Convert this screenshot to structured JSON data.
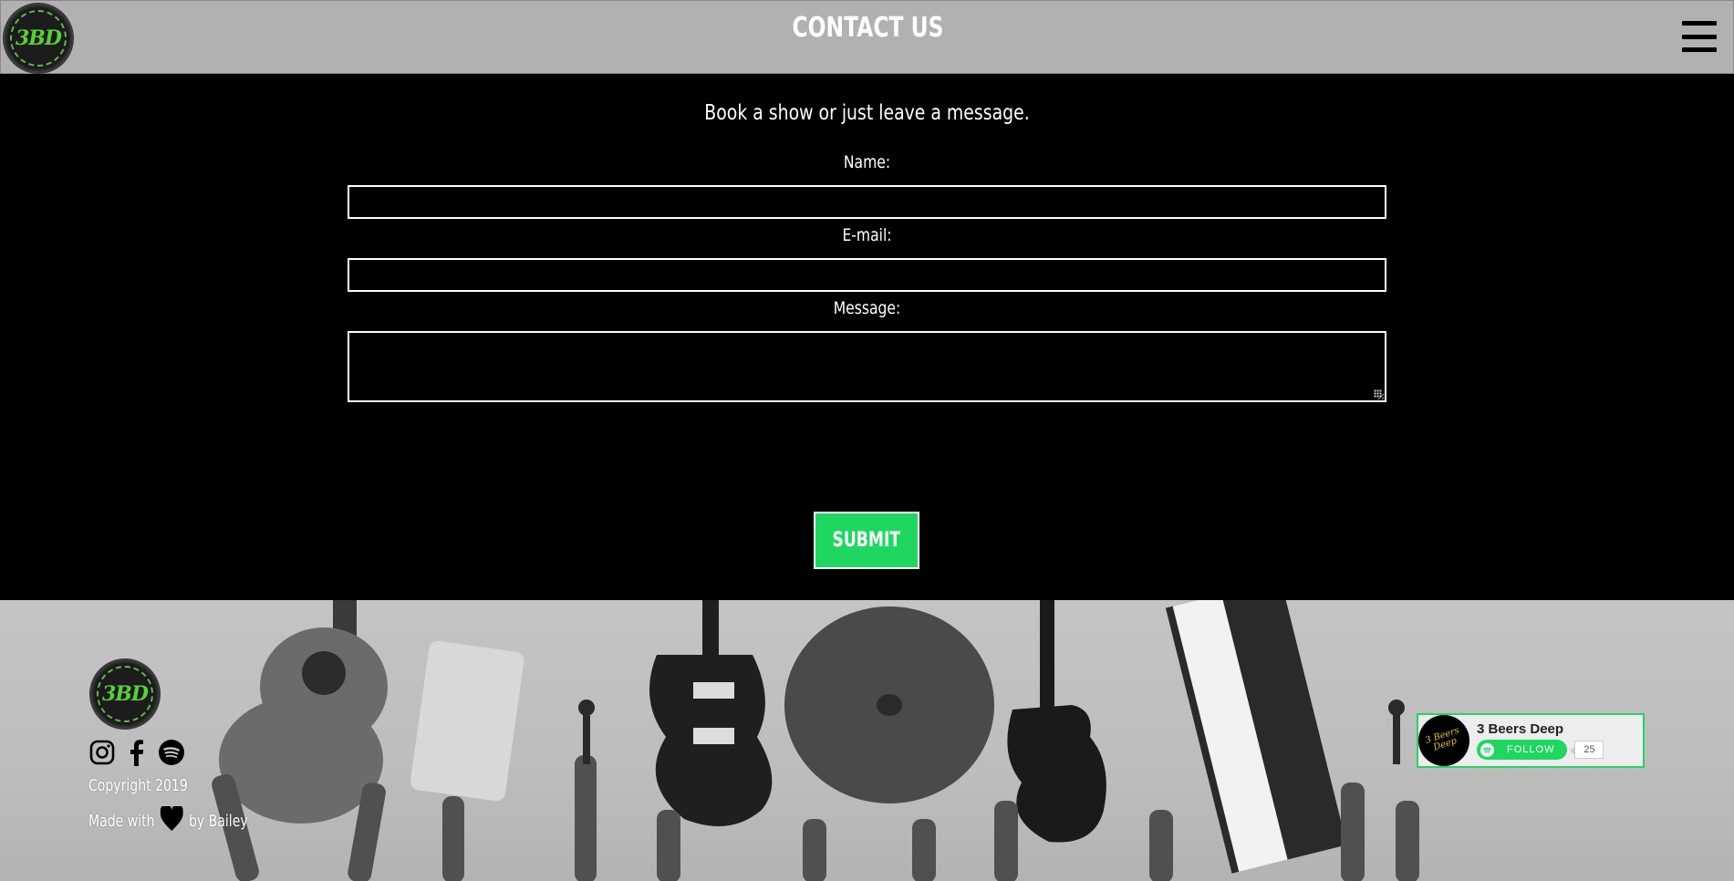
{
  "header": {
    "logo_text": "3BD",
    "title": "CONTACT US"
  },
  "contact": {
    "intro": "Book a show or just leave a message.",
    "name_label": "Name:",
    "email_label": "E-mail:",
    "message_label": "Message:",
    "name_value": "",
    "email_value": "",
    "message_value": "",
    "submit_label": "SUBMIT"
  },
  "footer": {
    "logo_text": "3BD",
    "social_icons": [
      "instagram-icon",
      "facebook-icon",
      "spotify-icon"
    ],
    "copyright": "Copyright 2019",
    "made_with_prefix": "Made with",
    "made_with_suffix": "by Bailey"
  },
  "spotify_widget": {
    "artist": "3 Beers Deep",
    "avatar_text": "3 Beers Deep",
    "follow_label": "FOLLOW",
    "follower_count": "25"
  },
  "colors": {
    "header_bg": "#b1b1b1",
    "main_bg": "#000000",
    "accent_green": "#1fd760",
    "logo_green": "#58d03a"
  }
}
